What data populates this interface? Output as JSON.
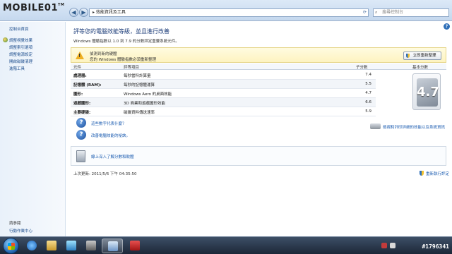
{
  "logo": {
    "text": "MOBILE01",
    "tm": "TM"
  },
  "address": {
    "path": "▸ 效能資訊及工具"
  },
  "search": {
    "placeholder": "搜尋控制台"
  },
  "sidebar": {
    "home": "控制台首頁",
    "items": [
      {
        "label": "調整視覺效果"
      },
      {
        "label": "調整索引選項"
      },
      {
        "label": "調整電源設定"
      },
      {
        "label": "開啟磁碟清理"
      },
      {
        "label": "進階工具"
      }
    ],
    "see_also": "請參閱",
    "action_center": "行動作業中心"
  },
  "main": {
    "title": "評等您的電腦效能等級，並且進行改善",
    "description": "Windows 體驗指數以 1.0 到 7.9 的分數評定重要系統元件。",
    "warning": {
      "line1": "偵測到新的硬體",
      "line2": "您的 Windows 體驗指數必須重新整理",
      "button": "立即重新整理"
    },
    "table": {
      "headers": {
        "component": "元件",
        "rating": "評等項目",
        "subscore": "子分數",
        "basescore": "基本分數"
      },
      "rows": [
        {
          "component": "處理器:",
          "rating": "每秒當科計算量",
          "score": "7.4"
        },
        {
          "component": "記憶體 (RAM):",
          "rating": "每秒的記憶體運算",
          "score": "5.5"
        },
        {
          "component": "圖形:",
          "rating": "Windows Aero 的桌面效能",
          "score": "4.7"
        },
        {
          "component": "遊戲圖形:",
          "rating": "3D 商業和遊戲圖形效能",
          "score": "6.6"
        },
        {
          "component": "主要硬碟:",
          "rating": "磁碟資料傳送速率",
          "score": "5.9"
        }
      ],
      "base_score": "4.7"
    },
    "links": {
      "what_mean": "這些數字代表什麼？",
      "improve": "改善電腦效能的祕訣。",
      "print": "檢視和列印詳細的效能以及系統資訊",
      "learn_more": "線上深入了解分數和軟體"
    },
    "last_update": "上次更新: 2011/5/6 下午 04:35:50",
    "rerun": "重新執行評定"
  },
  "taskbar": {
    "watermark": "#1796341"
  }
}
